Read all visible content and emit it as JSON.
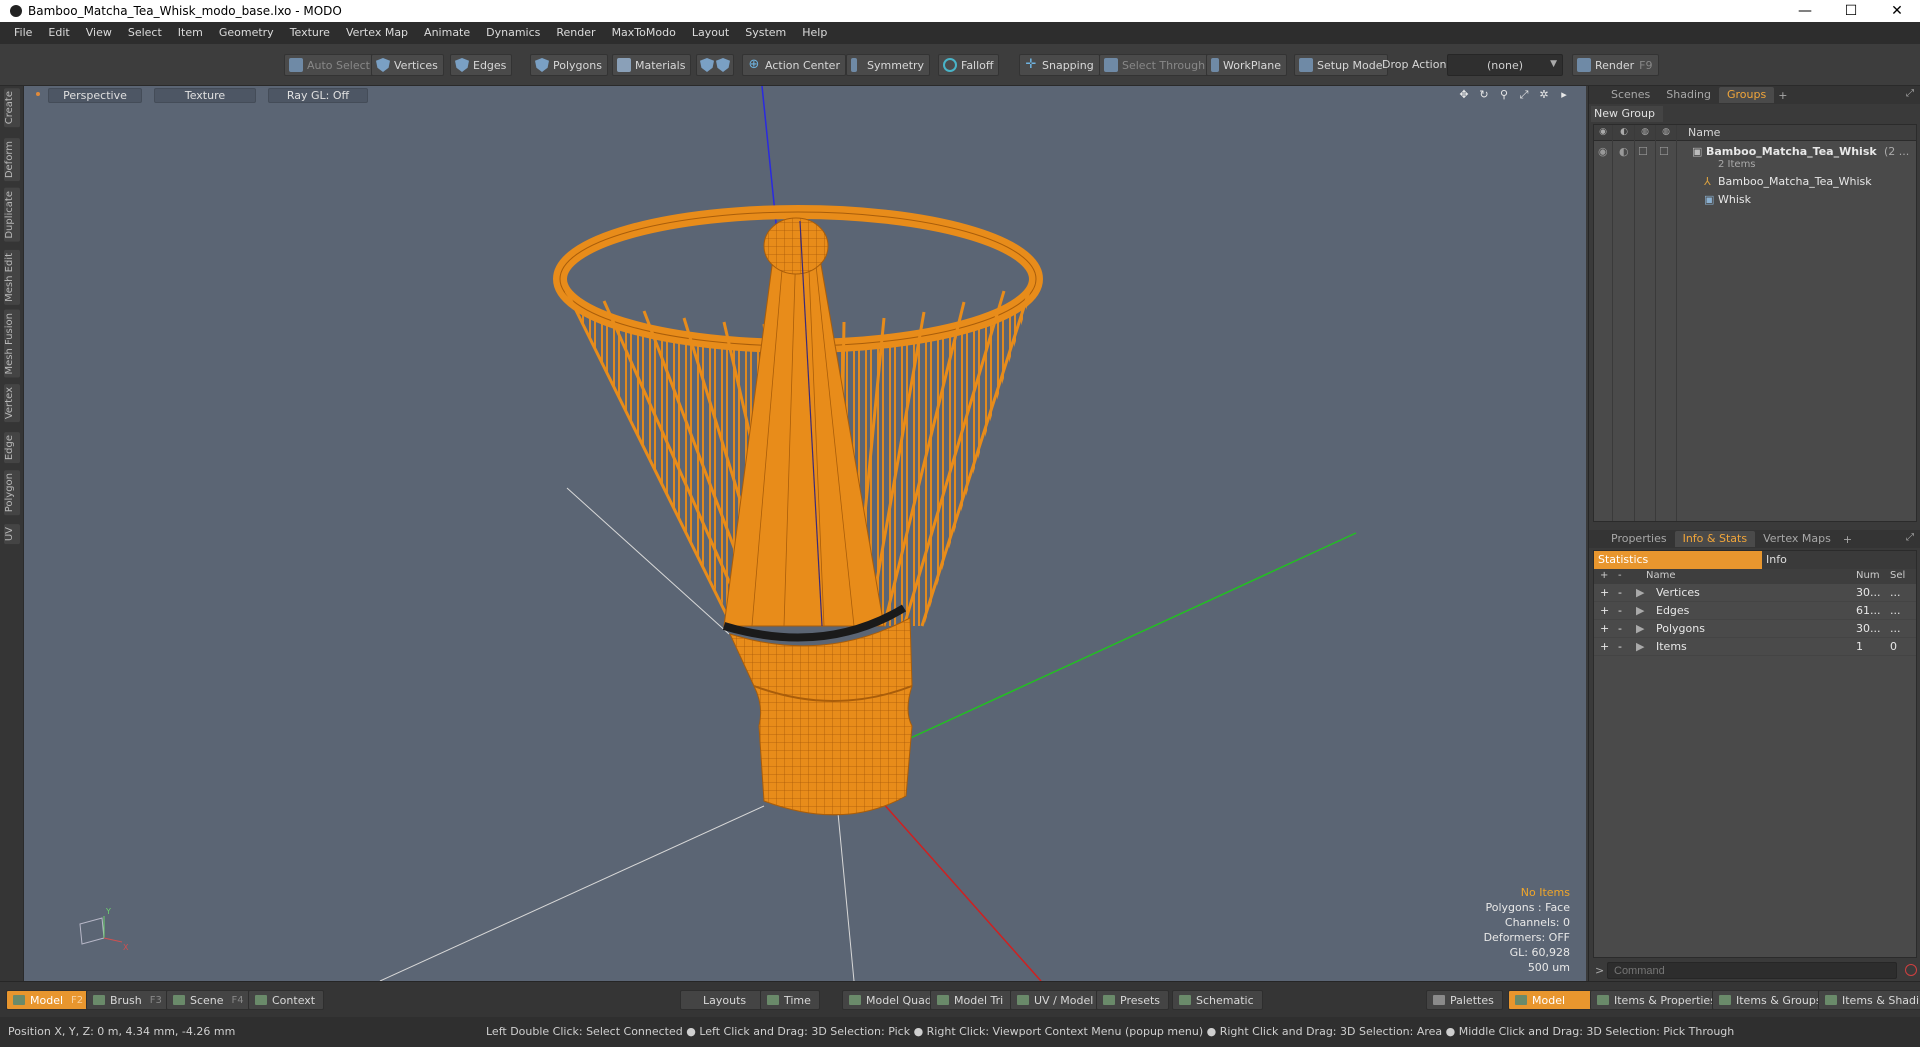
{
  "window": {
    "title": "Bamboo_Matcha_Tea_Whisk_modo_base.lxo - MODO",
    "controls": [
      "—",
      "☐",
      "✕"
    ]
  },
  "menu": [
    "File",
    "Edit",
    "View",
    "Select",
    "Item",
    "Geometry",
    "Texture",
    "Vertex Map",
    "Animate",
    "Dynamics",
    "Render",
    "MaxToModo",
    "Layout",
    "System",
    "Help"
  ],
  "toolbar": {
    "auto_select": "Auto Select",
    "vertices": "Vertices",
    "edges": "Edges",
    "polygons": "Polygons",
    "materials": "Materials",
    "action_center": "Action Center",
    "symmetry": "Symmetry",
    "falloff": "Falloff",
    "snapping": "Snapping",
    "select_through": "Select Through",
    "workplane": "WorkPlane",
    "setup_mode": "Setup Mode",
    "drop_action_label": "Drop Action",
    "drop_action_value": "(none)",
    "render": "Render",
    "render_key": "F9"
  },
  "left_tabs": [
    "Create",
    "Deform",
    "Duplicate",
    "Mesh Edit",
    "Mesh Fusion",
    "Vertex",
    "Edge",
    "Polygon",
    "UV"
  ],
  "viewport": {
    "view_mode": "Perspective",
    "shading": "Texture",
    "raygl": "Ray GL: Off",
    "tools": [
      "✥",
      "↻",
      "⚲",
      "⤢",
      "✲",
      "▸"
    ],
    "overlay": {
      "selection": "No Items",
      "polygons": "Polygons : Face",
      "channels": "Channels: 0",
      "deformers": "Deformers: OFF",
      "gl": "GL: 60,928",
      "units": "500 um"
    },
    "axis_labels": {
      "y": "Y",
      "x": "X"
    }
  },
  "scene_panel": {
    "tabs": [
      "Scenes",
      "Shading",
      "Groups"
    ],
    "active_tab": "Groups",
    "new_group": "New Group",
    "column_name": "Name",
    "group": {
      "name": "Bamboo_Matcha_Tea_Whisk",
      "count_suffix": "(2 ...",
      "subtitle": "2 Items",
      "children": [
        "Bamboo_Matcha_Tea_Whisk",
        "Whisk"
      ]
    }
  },
  "stats_panel": {
    "tabs": [
      "Properties",
      "Info & Stats",
      "Vertex Maps"
    ],
    "active_tab": "Info & Stats",
    "subtabs": [
      "Statistics",
      "Info"
    ],
    "columns": {
      "name": "Name",
      "num": "Num",
      "sel": "Sel"
    },
    "rows": [
      {
        "name": "Vertices",
        "num": "30...",
        "sel": "..."
      },
      {
        "name": "Edges",
        "num": "61...",
        "sel": "..."
      },
      {
        "name": "Polygons",
        "num": "30...",
        "sel": "..."
      },
      {
        "name": "Items",
        "num": "1",
        "sel": "0"
      }
    ],
    "command_placeholder": "Command"
  },
  "modebar": {
    "model": "Model",
    "model_key": "F2",
    "brush": "Brush",
    "brush_key": "F3",
    "scene": "Scene",
    "scene_key": "F4",
    "context": "Context",
    "layouts": "Layouts",
    "time": "Time",
    "model_quad": "Model Quad",
    "model_tri": "Model Tri",
    "uv_model": "UV / Model",
    "presets": "Presets",
    "schematic": "Schematic",
    "palettes": "Palettes",
    "model_right": "Model",
    "items_properties": "Items & Properties",
    "items_groups": "Items & Groups",
    "items_shading": "Items & Shading"
  },
  "status": {
    "position": "Position X, Y, Z:   0 m, 4.34 mm, -4.26 mm",
    "hint": "Left Double Click: Select Connected ● Left Click and Drag: 3D Selection: Pick ● Right Click: Viewport Context Menu (popup menu) ● Right Click and Drag: 3D Selection: Area ● Middle Click and Drag: 3D Selection: Pick Through"
  },
  "colors": {
    "accent": "#e8962e",
    "viewport_bg": "#5b6574",
    "mesh": "#e88c1a",
    "axis_x": "#d02020",
    "axis_y": "#2020e0",
    "axis_z": "#20c020"
  }
}
